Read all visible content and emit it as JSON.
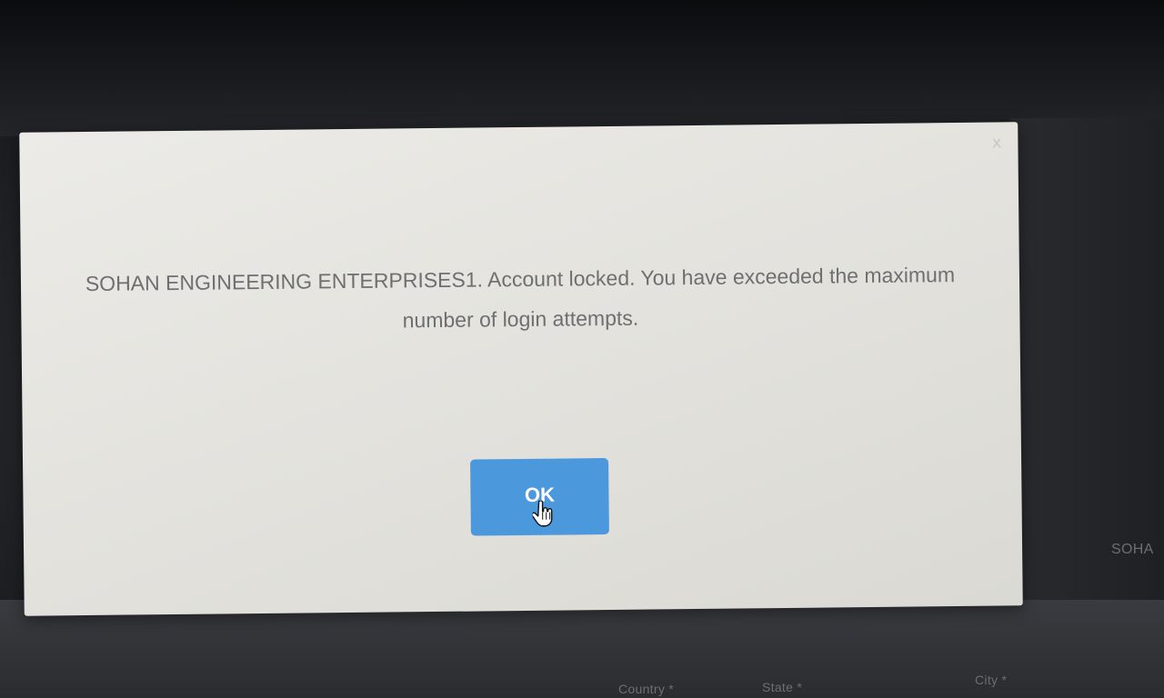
{
  "dialog": {
    "message": "SOHAN ENGINEERING ENTERPRISES1. Account locked. You have exceeded the maximum number of login attempts.",
    "ok_label": "OK",
    "close_glyph": "x",
    "accent_color": "#4c98dd"
  },
  "background_form": {
    "country_label": "Country *",
    "state_label": "State *",
    "city_label": "City *",
    "company_partial": "SOHA"
  },
  "icons": {
    "close": "close-icon",
    "cursor": "hand-cursor-icon"
  }
}
